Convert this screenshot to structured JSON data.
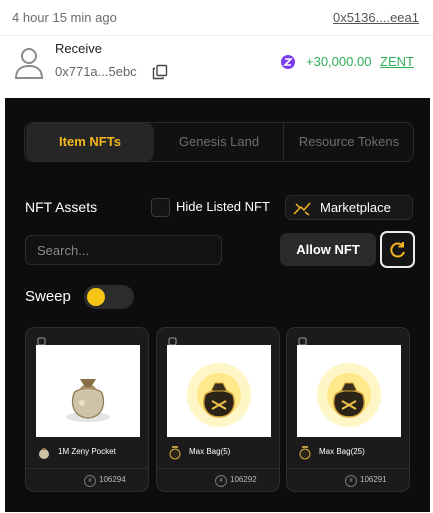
{
  "transaction": {
    "time": "4 hour 15 min ago",
    "hash": "0x5136....eea1",
    "type": "Receive",
    "from_address": "0x771a...5ebc",
    "amount": "+30,000.00",
    "token": "ZENT",
    "amount_color": "#2fae57",
    "icons": {
      "sender": "user-avatar-icon",
      "copy": "copy-icon",
      "token": "zent-token-icon"
    }
  },
  "tabs": [
    {
      "label": "Item NFTs",
      "active": true
    },
    {
      "label": "Genesis Land",
      "active": false
    },
    {
      "label": "Resource Tokens",
      "active": false
    }
  ],
  "toolbar": {
    "assets_label": "NFT Assets",
    "hide_listed_label": "Hide Listed NFT",
    "hide_listed_checked": false,
    "marketplace_label": "Marketplace",
    "search_placeholder": "Search...",
    "allow_label": "Allow NFT",
    "refresh_icon": "refresh-icon"
  },
  "sweep": {
    "label": "Sweep",
    "enabled": false
  },
  "accent_color": "#f5b51e",
  "cards": [
    {
      "name": "1M Zeny Pocket",
      "id": "106294",
      "item": "zeny-pouch"
    },
    {
      "name": "Max Bag(5)",
      "id": "106292",
      "item": "max-bag"
    },
    {
      "name": "Max Bag(25)",
      "id": "106291",
      "item": "max-bag"
    }
  ]
}
